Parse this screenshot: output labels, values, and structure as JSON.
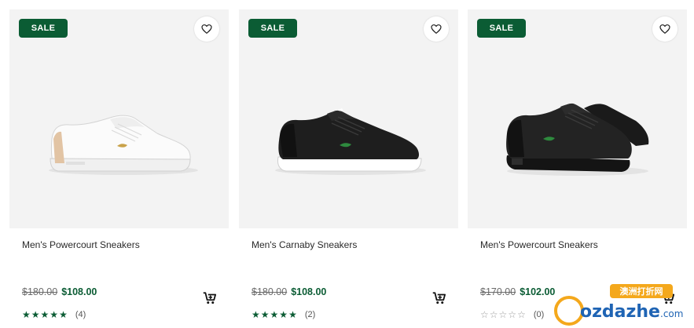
{
  "colors": {
    "accent": "#0b5c34",
    "image_bg": "#f3f3f3"
  },
  "products": [
    {
      "badge": "SALE",
      "name": "Men's Powercourt Sneakers",
      "old_price": "$180.00",
      "new_price": "$108.00",
      "rating": 5,
      "reviews": "(4)"
    },
    {
      "badge": "SALE",
      "name": "Men's Carnaby Sneakers",
      "old_price": "$180.00",
      "new_price": "$108.00",
      "rating": 5,
      "reviews": "(2)"
    },
    {
      "badge": "SALE",
      "name": "Men's Powercourt Sneakers",
      "old_price": "$170.00",
      "new_price": "$102.00",
      "rating": 0,
      "reviews": "(0)"
    }
  ],
  "watermark": {
    "top": "澳洲打折网",
    "main": "ozdazhe",
    "suffix": ".com"
  },
  "icons": {
    "wishlist": "heart-icon",
    "cart": "add-to-cart-icon",
    "star": "star-icon"
  }
}
